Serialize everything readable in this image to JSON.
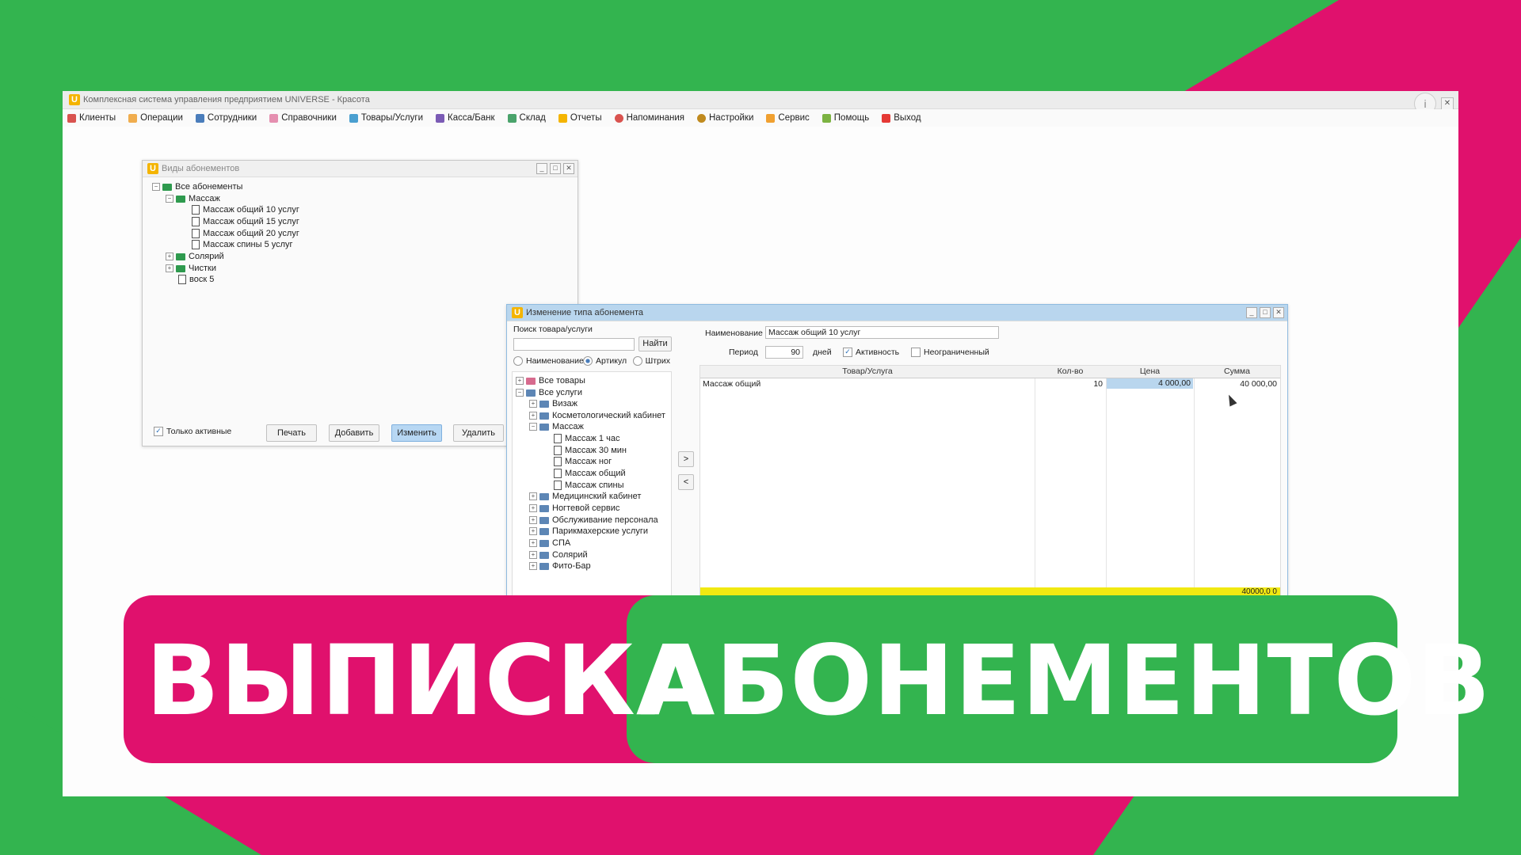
{
  "app": {
    "title": "Комплексная система управления предприятием UNIVERSE - Красота",
    "logo_letter": "U",
    "info_symbol": "i",
    "close_symbol": "✕"
  },
  "menu": [
    {
      "label": "Клиенты",
      "icon": "clients-icon",
      "color": "#d9534f"
    },
    {
      "label": "Операции",
      "icon": "operations-icon",
      "color": "#f0ad4e"
    },
    {
      "label": "Сотрудники",
      "icon": "staff-icon",
      "color": "#4a7dbb"
    },
    {
      "label": "Справочники",
      "icon": "directories-icon",
      "color": "#e58fb0"
    },
    {
      "label": "Товары/Услуги",
      "icon": "goods-icon",
      "color": "#4a9fd0"
    },
    {
      "label": "Касса/Банк",
      "icon": "cash-icon",
      "color": "#7b5bb5"
    },
    {
      "label": "Склад",
      "icon": "warehouse-icon",
      "color": "#4aa36b"
    },
    {
      "label": "Отчеты",
      "icon": "reports-icon",
      "color": "#f4b400"
    },
    {
      "label": "Напоминания",
      "icon": "reminders-icon",
      "color": "#d9534f"
    },
    {
      "label": "Настройки",
      "icon": "settings-icon",
      "color": "#c08a1e"
    },
    {
      "label": "Сервис",
      "icon": "service-icon",
      "color": "#f0a030"
    },
    {
      "label": "Помощь",
      "icon": "help-icon",
      "color": "#7cb342"
    },
    {
      "label": "Выход",
      "icon": "exit-icon",
      "color": "#e53935"
    }
  ],
  "subs_window": {
    "title": "Виды абонементов",
    "tree": [
      {
        "label": "Все абонементы"
      },
      {
        "label": "Массаж"
      },
      {
        "label": "Массаж общий 10 услуг"
      },
      {
        "label": "Массаж общий 15 услуг"
      },
      {
        "label": "Массаж общий 20 услуг"
      },
      {
        "label": "Массаж спины 5 услуг"
      },
      {
        "label": "Солярий"
      },
      {
        "label": "Чистки"
      },
      {
        "label": "воск 5"
      }
    ],
    "only_active_label": "Только активные",
    "buttons": {
      "print": "Печать",
      "add": "Добавить",
      "edit": "Изменить",
      "delete": "Удалить"
    }
  },
  "edit_window": {
    "title": "Изменение типа абонемента",
    "search_label": "Поиск товара/услуги",
    "find_button": "Найти",
    "radio_name": "Наименование",
    "radio_article": "Артикул",
    "radio_barcode": "Штрих",
    "tree": [
      {
        "label": "Все товары"
      },
      {
        "label": "Все услуги"
      },
      {
        "label": "Визаж"
      },
      {
        "label": "Косметологический кабинет"
      },
      {
        "label": "Массаж"
      },
      {
        "label": "Массаж 1 час"
      },
      {
        "label": "Массаж 30 мин"
      },
      {
        "label": "Массаж ног"
      },
      {
        "label": "Массаж общий"
      },
      {
        "label": "Массаж спины"
      },
      {
        "label": "Медицинский кабинет"
      },
      {
        "label": "Ногтевой сервис"
      },
      {
        "label": "Обслуживание персонала"
      },
      {
        "label": "Парикмахерские услуги"
      },
      {
        "label": "СПА"
      },
      {
        "label": "Солярий"
      },
      {
        "label": "Фито-Бар"
      }
    ],
    "move_right": ">",
    "move_left": "<",
    "name_label": "Наименование",
    "name_value": "Массаж общий 10 услуг",
    "period_label": "Период",
    "period_value": "90",
    "days_label": "дней",
    "active_label": "Активность",
    "unlimited_label": "Неограниченный",
    "columns": {
      "item": "Товар/Услуга",
      "qty": "Кол-во",
      "price": "Цена",
      "sum": "Сумма"
    },
    "rows": [
      {
        "item": "Массаж общий",
        "qty": "10",
        "price": "4 000,00",
        "sum": "40 000,00"
      }
    ],
    "total": "40000,0 0"
  },
  "banner": {
    "left_word": "ВЫПИСКА",
    "right_word": "АБОНЕМЕНТОВ",
    "pink": "#e0116d",
    "green": "#33b44f"
  }
}
